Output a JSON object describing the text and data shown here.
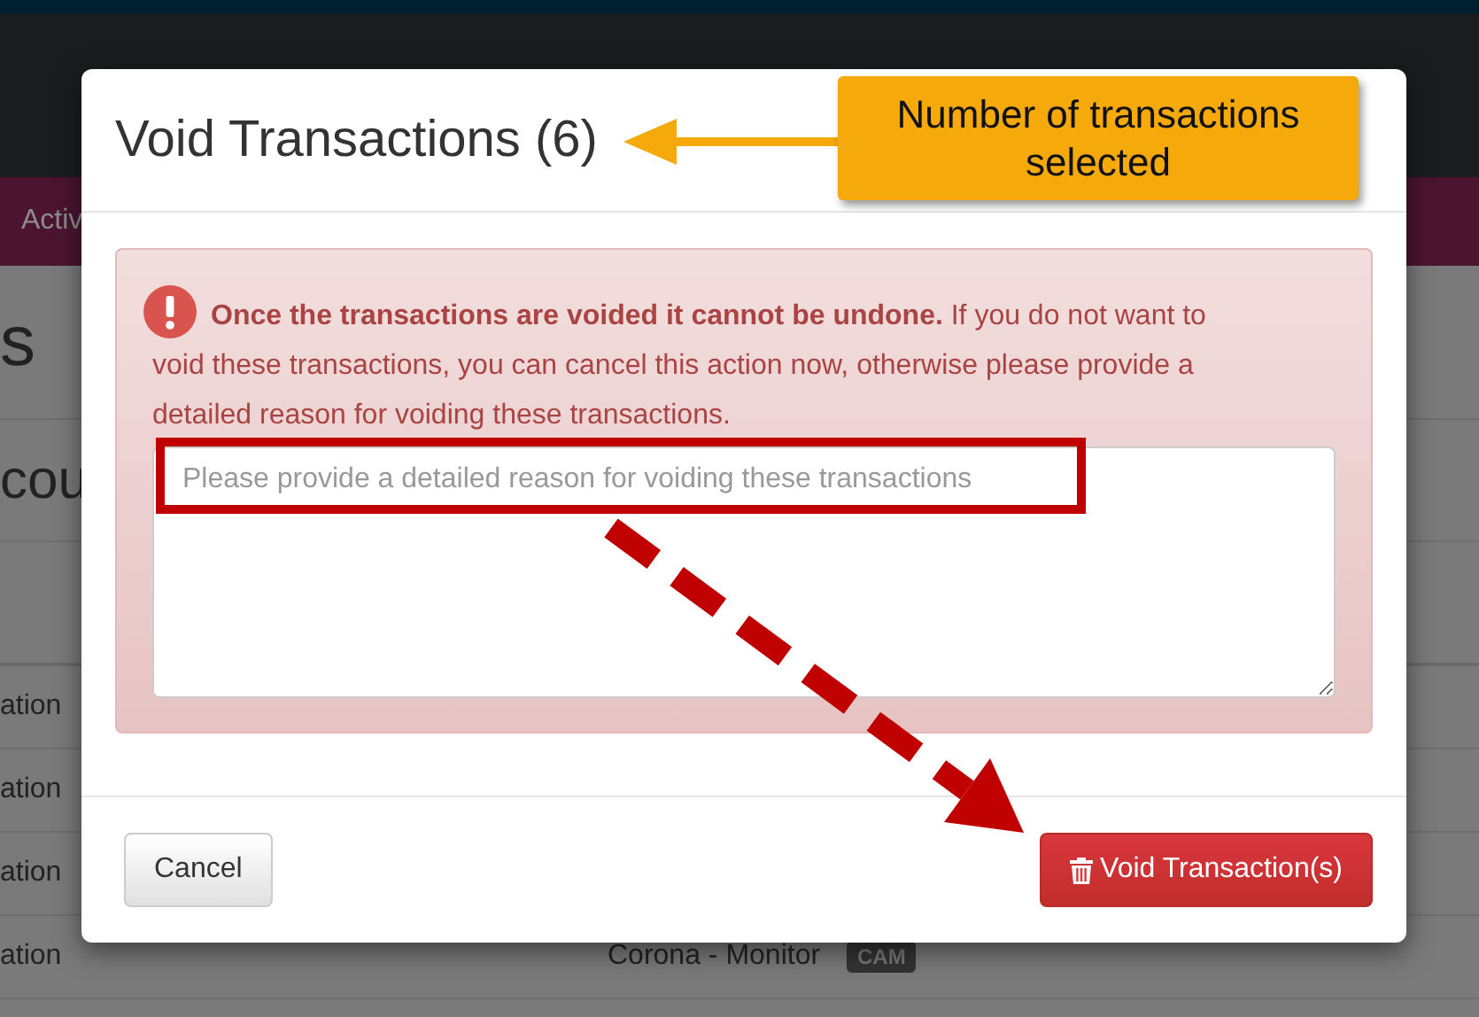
{
  "background_page": {
    "nav_item": "Activ",
    "heading": "s",
    "subheading": "cou",
    "rows": [
      {
        "column_1": "ation"
      },
      {
        "column_1": "ation"
      },
      {
        "column_1": "ation"
      },
      {
        "column_1": "ation",
        "column_2": "Corona - Monitor",
        "tag": "CAM"
      }
    ]
  },
  "dialog": {
    "title": "Void Transactions (6)",
    "alert": {
      "text": "**Once the transactions are voided it cannot be undone.** If you do not want to void these transactions, you can cancel this action now, otherwise please provide a detailed reason for voiding these transactions."
    },
    "reason_field": {
      "placeholder": "Please provide a detailed reason for voiding these transactions"
    },
    "buttons": [
      {
        "kind": "default",
        "label": "Cancel"
      },
      {
        "kind": "danger",
        "label": "Void Transaction(s)"
      }
    ]
  },
  "annotations": [
    {
      "kind": "callout",
      "text": "Number of transactions selected"
    },
    {
      "kind": "highlight"
    },
    {
      "kind": "dashed-arrow"
    }
  ]
}
